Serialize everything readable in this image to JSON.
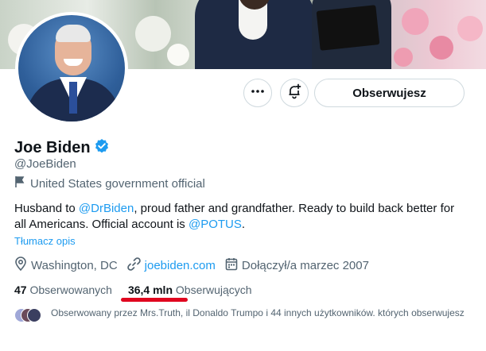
{
  "profile": {
    "name": "Joe Biden",
    "handle": "@JoeBiden",
    "category": "United States government official",
    "bio": {
      "part1": "Husband to ",
      "mention1": "@DrBiden",
      "part2": ", proud father and grandfather. Ready to build back better for all Americans. Official account is ",
      "mention2": "@POTUS",
      "part3": "."
    },
    "translate_label": "Tłumacz opis",
    "location": "Washington, DC",
    "website": "joebiden.com",
    "joined": "Dołączył/a marzec 2007"
  },
  "actions": {
    "follow_label": "Obserwujesz"
  },
  "stats": {
    "following_count": "47",
    "following_label": "Obserwowanych",
    "followers_count": "36,4 mln",
    "followers_label": "Obserwujących"
  },
  "followed_by": {
    "text": "Obserwowany przez Mrs.Truth, il Donaldo Trumpo i 44 innych użytkowników. których obserwujesz"
  },
  "colors": {
    "accent": "#1d9bf0",
    "annotation_underline": "#e0061f",
    "verified": "#1d9bf0"
  },
  "icons": [
    "more-icon",
    "notification-bell-icon",
    "verified-badge-icon",
    "flag-icon",
    "location-pin-icon",
    "link-icon",
    "calendar-icon"
  ]
}
